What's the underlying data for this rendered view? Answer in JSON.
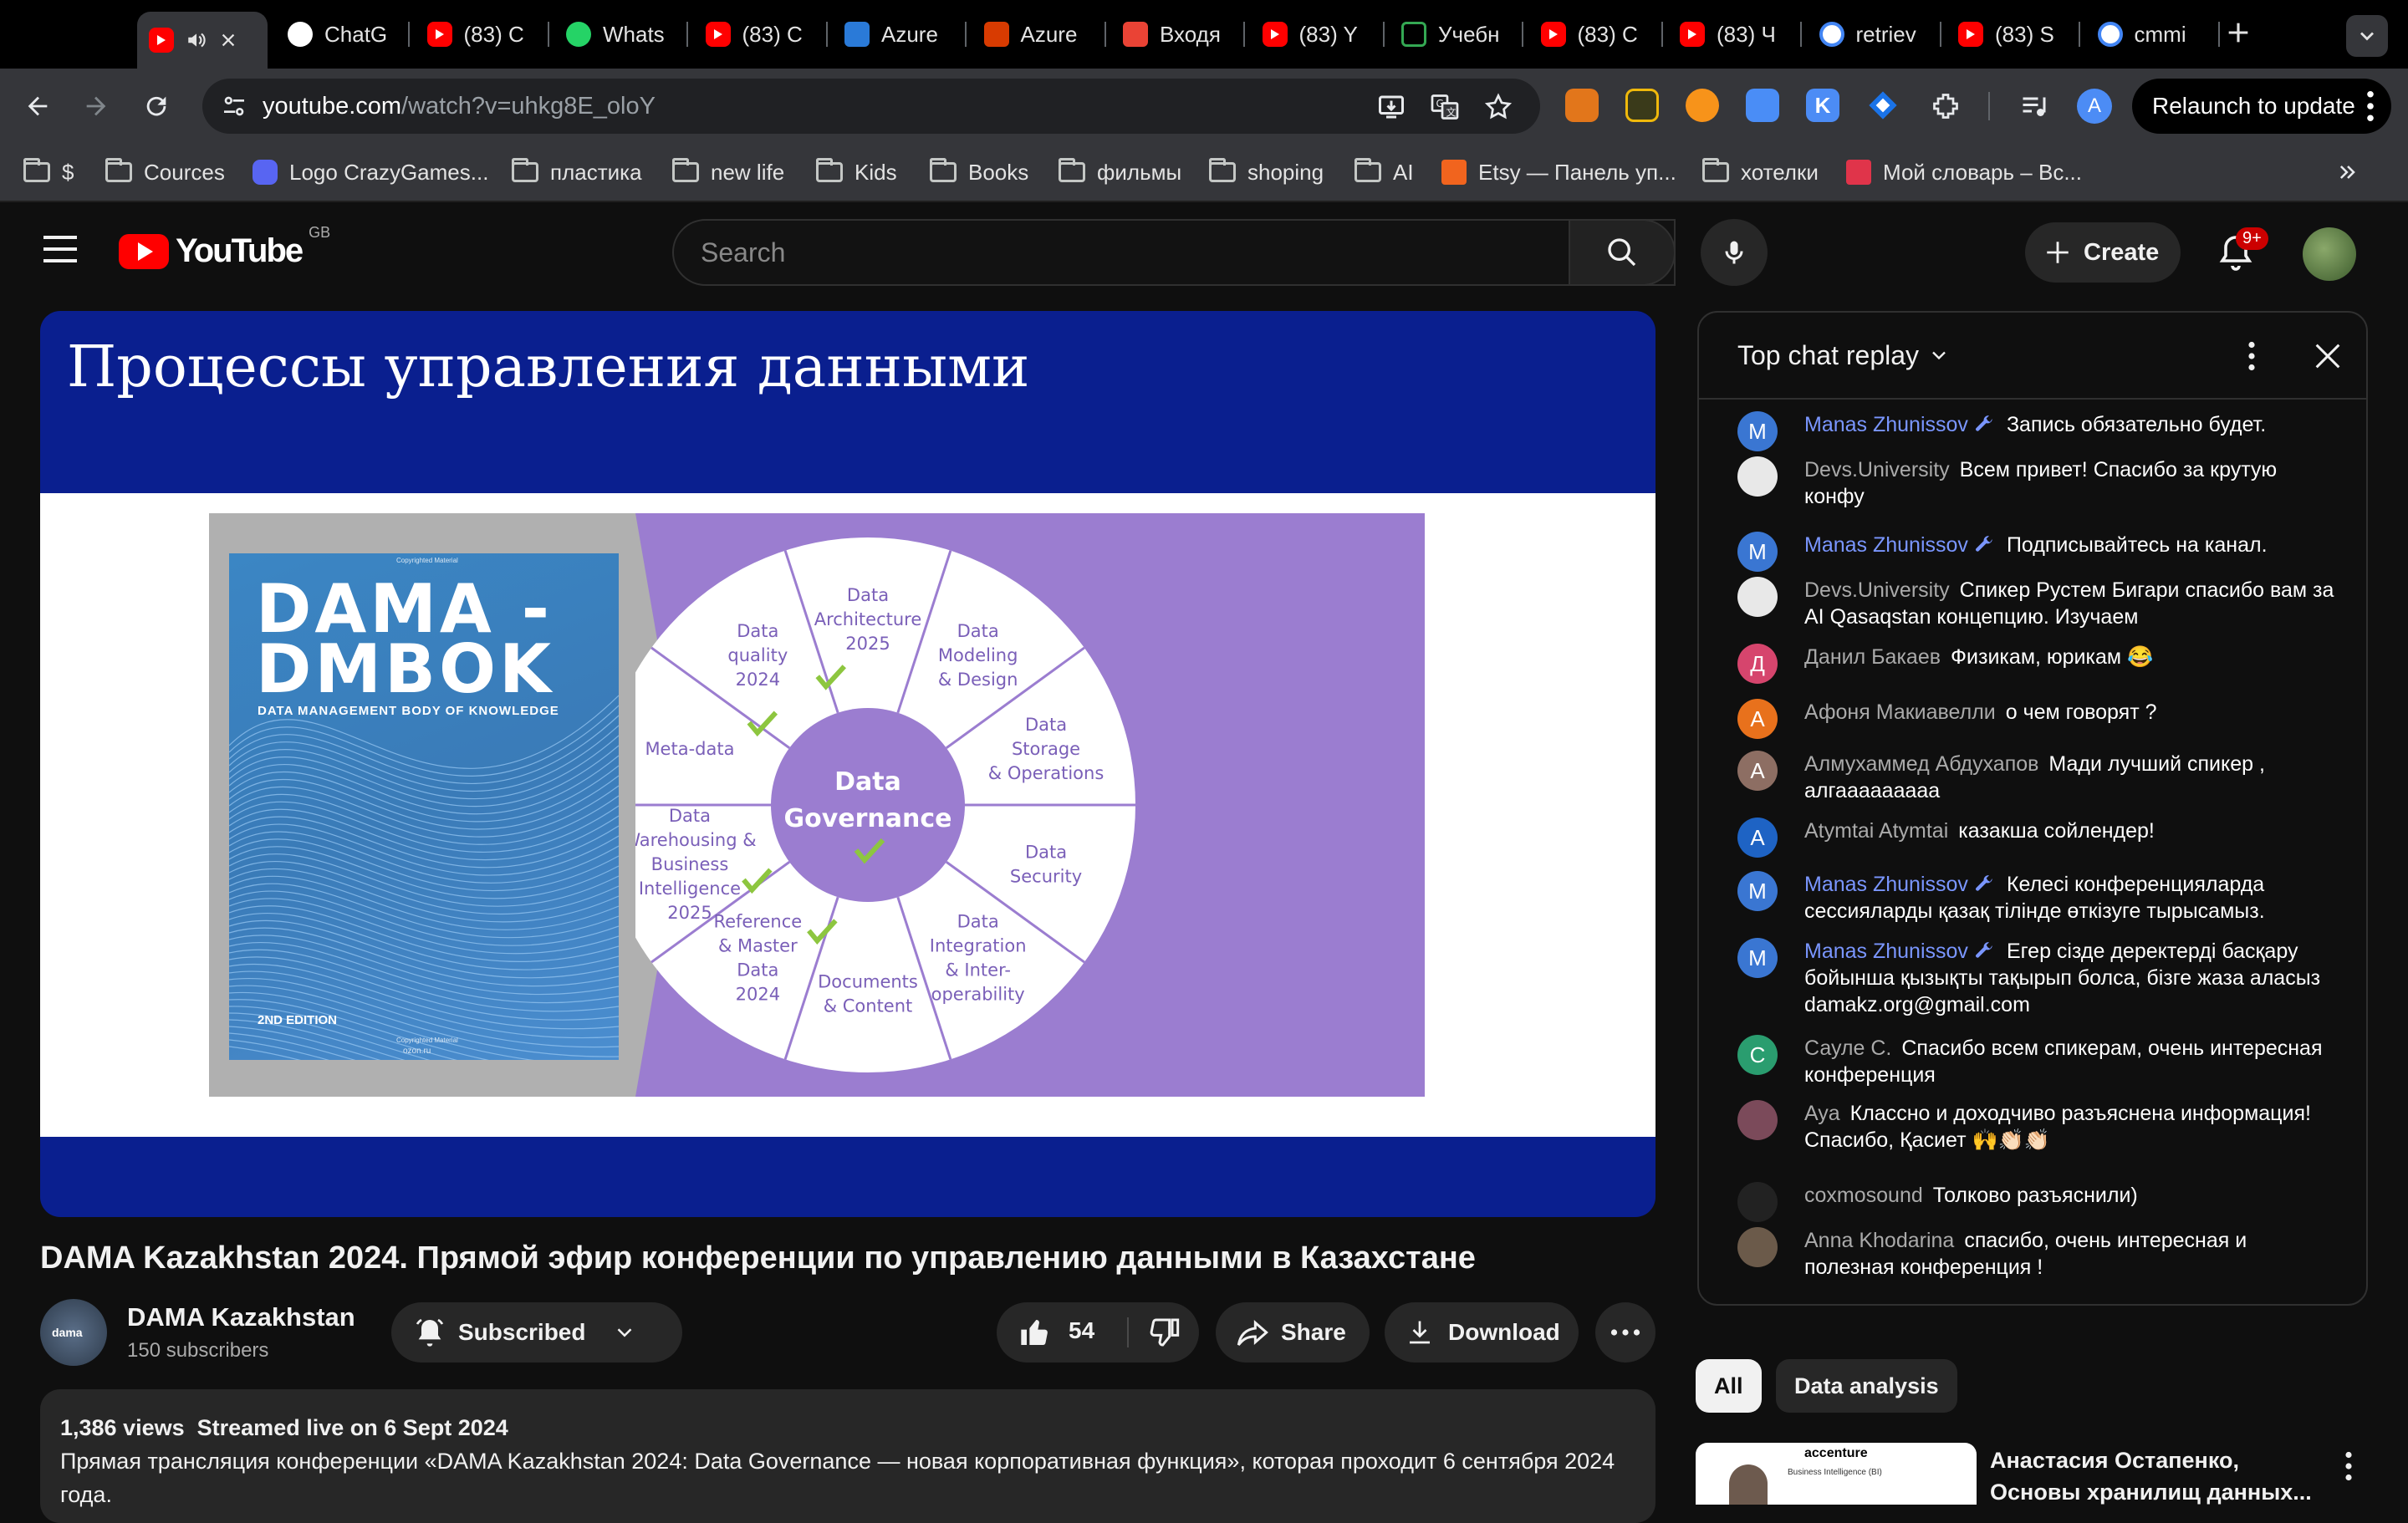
{
  "browser": {
    "tabs": [
      {
        "label": "",
        "icon": "youtube-icon",
        "active": true
      },
      {
        "label": "ChatG",
        "icon": "chatgpt-icon"
      },
      {
        "label": "(83) C",
        "icon": "youtube-icon"
      },
      {
        "label": "Whats",
        "icon": "whatsapp-icon"
      },
      {
        "label": "(83) C",
        "icon": "youtube-icon"
      },
      {
        "label": "Azure",
        "icon": "azure-icon"
      },
      {
        "label": "Azure",
        "icon": "azure-devops-icon"
      },
      {
        "label": "Входя",
        "icon": "gmail-icon"
      },
      {
        "label": "(83) Y",
        "icon": "youtube-icon"
      },
      {
        "label": "Учебн",
        "icon": "loading-icon"
      },
      {
        "label": "(83) C",
        "icon": "youtube-icon"
      },
      {
        "label": "(83) Ч",
        "icon": "youtube-icon"
      },
      {
        "label": "retriev",
        "icon": "google-icon"
      },
      {
        "label": "(83) S",
        "icon": "youtube-icon"
      },
      {
        "label": "cmmi",
        "icon": "google-icon"
      }
    ],
    "url_host": "youtube.com",
    "url_path": "/watch?v=uhkg8E_oloY",
    "relaunch_label": "Relaunch to update",
    "profile_initial": "A",
    "bookmarks": [
      {
        "label": "$",
        "type": "folder"
      },
      {
        "label": "Cources",
        "type": "folder"
      },
      {
        "label": "Logo CrazyGames...",
        "type": "site"
      },
      {
        "label": "пластика",
        "type": "folder"
      },
      {
        "label": "new life",
        "type": "folder"
      },
      {
        "label": "Kids",
        "type": "folder"
      },
      {
        "label": "Books",
        "type": "folder"
      },
      {
        "label": "фильмы",
        "type": "folder"
      },
      {
        "label": "shoping",
        "type": "folder"
      },
      {
        "label": "AI",
        "type": "folder"
      },
      {
        "label": "Etsy — Панель уп...",
        "type": "site"
      },
      {
        "label": "хотелки",
        "type": "folder"
      },
      {
        "label": "Мой словарь – Вс...",
        "type": "site"
      }
    ]
  },
  "youtube": {
    "logo_text": "YouTube",
    "region": "GB",
    "search_placeholder": "Search",
    "create_label": "Create",
    "notifications_badge": "9+"
  },
  "slide": {
    "title": "Процессы управления данными",
    "book_line1": "DAMA -",
    "book_line2": "DMBOK",
    "book_subtitle": "DATA MANAGEMENT BODY OF KNOWLEDGE",
    "book_edition": "2ND EDITION",
    "book_small_top": "Copyrighted Material",
    "book_small_bottom": "Copyrighted Material",
    "book_small_bottom2": "ozon.ru",
    "center_line1": "Data",
    "center_line2": "Governance",
    "segments": [
      {
        "lines": [
          "Data",
          "Architecture",
          "2025"
        ],
        "check": true
      },
      {
        "lines": [
          "Data",
          "Modeling",
          "& Design"
        ],
        "check": false
      },
      {
        "lines": [
          "Data",
          "Storage",
          "& Operations"
        ],
        "check": false
      },
      {
        "lines": [
          "Data",
          "Security"
        ],
        "check": false
      },
      {
        "lines": [
          "Data",
          "Integration",
          "& Inter-",
          "operability"
        ],
        "check": false
      },
      {
        "lines": [
          "Documents",
          "& Content"
        ],
        "check": false
      },
      {
        "lines": [
          "Reference",
          "& Master",
          "Data",
          "2024"
        ],
        "check": true
      },
      {
        "lines": [
          "Data",
          "Warehousing &",
          "Business",
          "Intelligence",
          "2025"
        ],
        "check": true
      },
      {
        "lines": [
          "Meta-data"
        ],
        "check": false
      },
      {
        "lines": [
          "Data",
          "quality",
          "2024"
        ],
        "check": true
      }
    ]
  },
  "chat": {
    "header": "Top chat replay",
    "messages": [
      {
        "author": "Manas Zhunissov",
        "owner": true,
        "initial": "M",
        "color": "#3a76d2",
        "text": "Запись обязательно будет."
      },
      {
        "author": "Devs.University",
        "owner": false,
        "initial": "",
        "color": "#e8e8e8",
        "text": "Всем привет! Спасибо за крутую конфу"
      },
      {
        "author": "Manas Zhunissov",
        "owner": true,
        "initial": "M",
        "color": "#3a76d2",
        "text": "Подписывайтесь на канал."
      },
      {
        "author": "Devs.University",
        "owner": false,
        "initial": "",
        "color": "#e8e8e8",
        "text": "Спикер Рустем Бигари спасибо вам за AI Qasaqstan концепцию. Изучаем"
      },
      {
        "author": "Данил Бакаев",
        "owner": false,
        "initial": "Д",
        "color": "#d6456d",
        "text": "Физикам, юрикам 😂"
      },
      {
        "author": "Афоня Макиавелли",
        "owner": false,
        "initial": "А",
        "color": "#e8711c",
        "text": "о чем говорят ?"
      },
      {
        "author": "Алмухаммед Абдухапов",
        "owner": false,
        "initial": "А",
        "color": "#8d6e63",
        "text": "Мади лучший спикер , алгааааааааа"
      },
      {
        "author": "Atymtai Atymtai",
        "owner": false,
        "initial": "A",
        "color": "#1e63c4",
        "text": "казакша сойлендер!"
      },
      {
        "author": "Manas Zhunissov",
        "owner": true,
        "initial": "M",
        "color": "#3a76d2",
        "text": "Келесі конференцияларда сессияларды қазақ тілінде өткізуге тырысамыз."
      },
      {
        "author": "Manas Zhunissov",
        "owner": true,
        "initial": "M",
        "color": "#3a76d2",
        "text": "Егер сізде деректерді басқару бойынша қызықты тақырып болса, бізге жаза аласыз damakz.org@gmail.com"
      },
      {
        "author": "Сауле С.",
        "owner": false,
        "initial": "С",
        "color": "#2a9d6f",
        "text": "Спасибо всем спикерам, очень интересная конференция"
      },
      {
        "author": "Aya",
        "owner": false,
        "initial": "",
        "color": "#7b4a5a",
        "text": "Классно и доходчиво разъяснена информация! Спасибо, Қасиет 🙌👏🏻👏🏻"
      },
      {
        "author": "coxmosound",
        "owner": false,
        "initial": "",
        "color": "#222222",
        "text": "Толково разъяснили)"
      },
      {
        "author": "Anna Khodarina",
        "owner": false,
        "initial": "",
        "color": "#6b5a4a",
        "text": "спасибо, очень интересная и полезная конференция !"
      }
    ]
  },
  "video": {
    "title": "DAMA Kazakhstan 2024. Прямой эфир конференции по управлению данными в Казахстане",
    "channel": "DAMA Kazakhstan",
    "subscribers": "150 subscribers",
    "subscribed_label": "Subscribed",
    "likes": "54",
    "share_label": "Share",
    "download_label": "Download",
    "views": "1,386 views",
    "streamed": "Streamed live on 6 Sept 2024",
    "description": "Прямая трансляция конференции «DAMA Kazakhstan 2024: Data Governance — новая корпоративная функция», которая проходит 6 сентября 2024 года."
  },
  "sidebar": {
    "chips": [
      "All",
      "Data analysis"
    ],
    "recommendation_title": "Анастасия Остапенко, Основы хранилищ данных...",
    "recommendation_thumb_brand": "accenture",
    "recommendation_thumb_text": "Business Intelligence (BI)"
  }
}
